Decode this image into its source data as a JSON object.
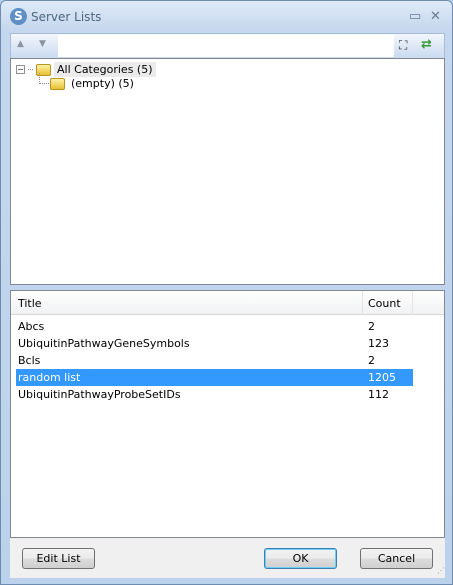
{
  "window": {
    "title": "Server Lists",
    "minimize_icon": "minimize-icon",
    "close_icon": "close-icon"
  },
  "toolbar": {
    "search_value": "",
    "up_icon": "arrow-up-icon",
    "down_icon": "arrow-down-icon",
    "find_icon": "binoculars-icon",
    "refresh_icon": "refresh-icon"
  },
  "tree": {
    "root": "All Categories (5)",
    "child": "(empty) (5)"
  },
  "list": {
    "columns": [
      "Title",
      "Count"
    ],
    "rows": [
      {
        "title": "Abcs",
        "count": "2"
      },
      {
        "title": "UbiquitinPathwayGeneSymbols",
        "count": "123"
      },
      {
        "title": "Bcls",
        "count": "2"
      },
      {
        "title": "random list",
        "count": "1205",
        "selected": true
      },
      {
        "title": "UbiquitinPathwayProbeSetIDs",
        "count": "112"
      }
    ]
  },
  "buttons": {
    "edit": "Edit List",
    "ok": "OK",
    "cancel": "Cancel"
  },
  "colors": {
    "selection": "#3399ff"
  }
}
